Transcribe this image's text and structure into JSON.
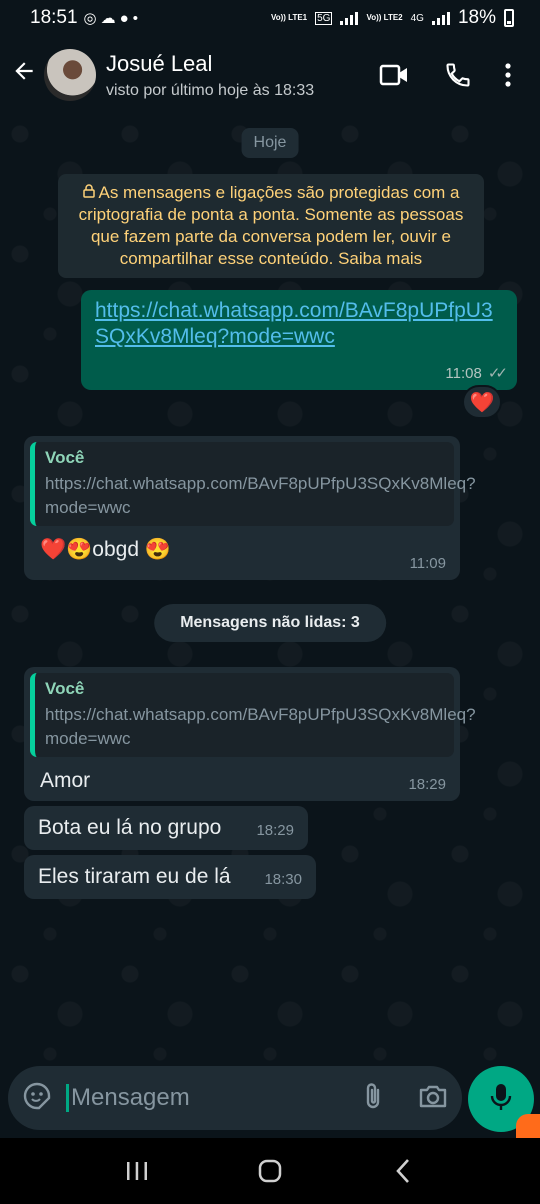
{
  "status_bar": {
    "time": "18:51",
    "sim1": "Vo)) LTE1",
    "sim1_net": "5G",
    "sim2": "Vo)) LTE2",
    "sim2_net": "4G",
    "battery": "18%"
  },
  "header": {
    "contact_name": "Josué Leal",
    "last_seen": "visto por último hoje às 18:33"
  },
  "chat": {
    "date_chip": "Hoje",
    "encryption_notice": "As mensagens e ligações são protegidas com a criptografia de ponta a ponta. Somente as pessoas que fazem parte da conversa podem ler, ouvir e compartilhar esse conteúdo. Saiba mais",
    "messages": [
      {
        "direction": "out",
        "text": "https://chat.whatsapp.com/BAvF8pUPfpU3SQxKv8Mleq?mode=wwc",
        "time": "11:08",
        "status": "read",
        "reaction": "❤️"
      },
      {
        "direction": "in",
        "quote_author": "Você",
        "quote_text": "https://chat.whatsapp.com/BAvF8pUPfpU3SQxKv8Mleq?mode=wwc",
        "text": "❤️😍obgd 😍",
        "time": "11:09"
      },
      {
        "direction": "in",
        "quote_author": "Você",
        "quote_text": "https://chat.whatsapp.com/BAvF8pUPfpU3SQxKv8Mleq?mode=wwc",
        "text": "Amor",
        "time": "18:29"
      },
      {
        "direction": "in",
        "text": "Bota eu lá no grupo",
        "time": "18:29"
      },
      {
        "direction": "in",
        "text": "Eles tiraram eu de lá",
        "time": "18:30"
      }
    ],
    "unread_label": "Mensagens não lidas: 3"
  },
  "composer": {
    "placeholder": "Mensagem"
  },
  "colors": {
    "background": "#0b141a",
    "outgoing_bubble": "#005c4b",
    "incoming_bubble": "#1f2c34",
    "accent": "#00a884",
    "link": "#53bdeb",
    "notice_text": "#ffd279"
  },
  "icons": [
    "back-arrow-icon",
    "video-call-icon",
    "phone-icon",
    "more-options-icon",
    "sticker-icon",
    "attach-icon",
    "camera-icon",
    "mic-icon",
    "recents-icon",
    "home-icon",
    "back-nav-icon"
  ]
}
